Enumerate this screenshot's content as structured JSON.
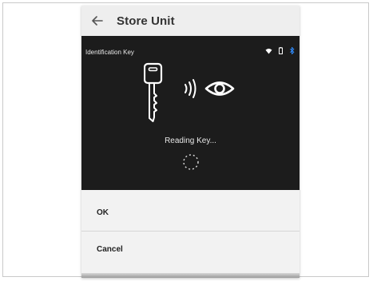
{
  "header": {
    "title": "Store Unit",
    "back_icon": "arrow-left-icon"
  },
  "status_bar": {
    "label": "Identification Key",
    "icons": [
      "wifi-icon",
      "battery-icon",
      "bluetooth-icon"
    ],
    "bluetooth_color": "#2f8cff"
  },
  "scan": {
    "status_text": "Reading Key...",
    "icons": [
      "key-icon",
      "signal-waves-icon",
      "eye-icon",
      "loading-spinner-icon"
    ]
  },
  "actions": {
    "ok_label": "OK",
    "cancel_label": "Cancel"
  },
  "colors": {
    "screen_bg": "#1c1c1c",
    "appbar_bg": "#eeeeee",
    "sheet_bg": "#f2f2f2"
  }
}
